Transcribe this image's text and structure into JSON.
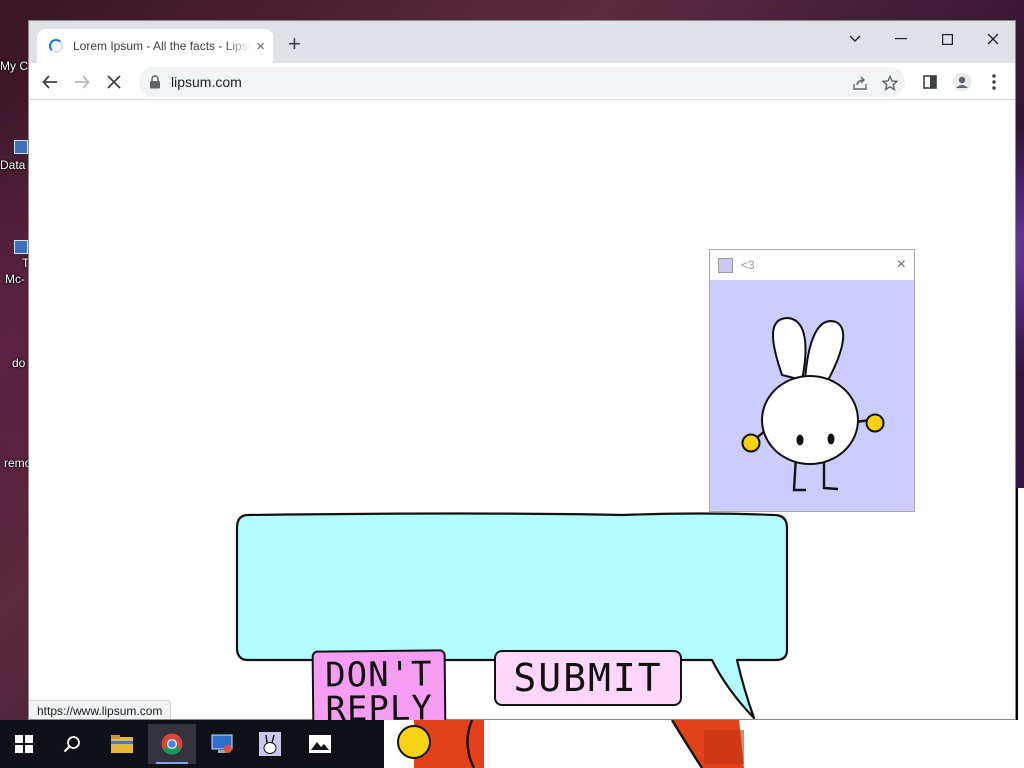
{
  "desktop": {
    "icons": [
      {
        "label": "My C"
      },
      {
        "label": "Data"
      },
      {
        "label": "T"
      },
      {
        "label": "Mc-"
      },
      {
        "label": "do"
      },
      {
        "label": "remo"
      }
    ]
  },
  "browser": {
    "tab": {
      "title": "Lorem Ipsum - All the facts - Lipsum generator",
      "close": "×",
      "loading": true
    },
    "new_tab": "+",
    "address_bar": {
      "url": "lipsum.com"
    },
    "status_url": "https://www.lipsum.com",
    "colors": {
      "tabstrip": "#dee1e6",
      "omnibox": "#f1f3f4",
      "spinner": "#1a73e8"
    }
  },
  "popup": {
    "title": "<3",
    "close": "×",
    "background": "#ccccff"
  },
  "speech_bubble": {
    "text": "",
    "fill": "#b3fcfd"
  },
  "buttons": {
    "dont_reply": {
      "line1": "DON'T",
      "line2": "REPLY",
      "fill": "#f59df2"
    },
    "submit": {
      "label": "SUBMIT",
      "fill": "#ffd6fb"
    }
  },
  "taskbar": {
    "icons": [
      "windows-start-icon",
      "search-icon",
      "file-explorer-icon",
      "chrome-icon",
      "remote-desktop-icon",
      "bunny-app-icon",
      "photos-icon"
    ]
  }
}
